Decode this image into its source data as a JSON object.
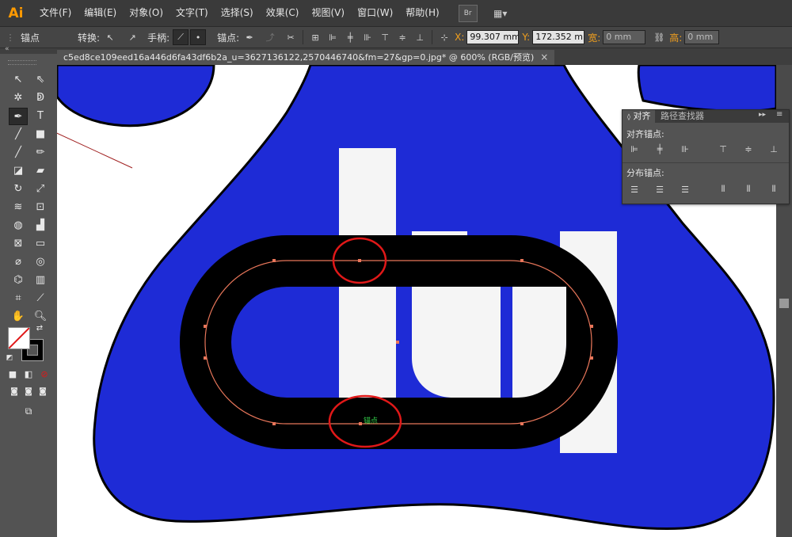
{
  "app": {
    "logo": "Ai"
  },
  "menu": {
    "items": [
      "文件(F)",
      "编辑(E)",
      "对象(O)",
      "文字(T)",
      "选择(S)",
      "效果(C)",
      "视图(V)",
      "窗口(W)",
      "帮助(H)"
    ],
    "bridge_btn": "Br"
  },
  "control": {
    "selection_label": "锚点",
    "convert_label": "转换:",
    "handles_label": "手柄:",
    "anchors_label": "锚点:",
    "x_label": "X:",
    "x_value": "99.307 mm",
    "y_label": "Y:",
    "y_value": "172.352 m",
    "w_label": "宽:",
    "w_value": "0 mm",
    "h_label": "高:",
    "h_value": "0 mm"
  },
  "document": {
    "tab_title": "c5ed8ce109eed16a446d6fa43df6b2a_u=3627136122,2570446740&fm=27&gp=0.jpg* @ 600% (RGB/预览)",
    "close_symbol": "×"
  },
  "canvas": {
    "anchor_hint": "锚点"
  },
  "align_panel": {
    "tab_align": "对齐",
    "tab_pathfinder": "路径查找器",
    "section_align": "对齐锚点:",
    "section_distribute": "分布锚点:"
  },
  "colors": {
    "blue_shape": "#1e2bd6",
    "highlight_circle": "#e01818",
    "path_line": "#e8765a",
    "anchor_label": "#33d24a"
  }
}
